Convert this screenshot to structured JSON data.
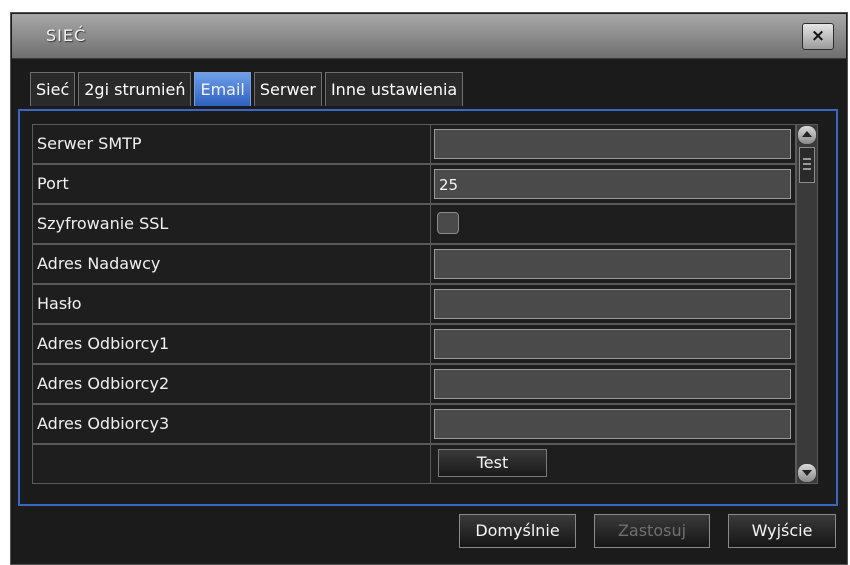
{
  "window": {
    "title": "SIEĆ",
    "close_label": "×"
  },
  "tabs": [
    {
      "label": "Sieć",
      "active": false
    },
    {
      "label": "2gi strumień",
      "active": false
    },
    {
      "label": "Email",
      "active": true
    },
    {
      "label": "Serwer",
      "active": false
    },
    {
      "label": "Inne ustawienia",
      "active": false
    }
  ],
  "form": {
    "rows": [
      {
        "label": "Serwer SMTP",
        "type": "text",
        "value": ""
      },
      {
        "label": "Port",
        "type": "text",
        "value": "25"
      },
      {
        "label": "Szyfrowanie SSL",
        "type": "checkbox",
        "checked": false
      },
      {
        "label": "Adres Nadawcy",
        "type": "text",
        "value": ""
      },
      {
        "label": "Hasło",
        "type": "text",
        "value": ""
      },
      {
        "label": "Adres Odbiorcy1",
        "type": "text",
        "value": ""
      },
      {
        "label": "Adres Odbiorcy2",
        "type": "text",
        "value": ""
      },
      {
        "label": "Adres Odbiorcy3",
        "type": "text",
        "value": ""
      },
      {
        "label": "",
        "type": "button",
        "button_label": "Test"
      }
    ]
  },
  "buttons": {
    "default_label": "Domyślnie",
    "apply_label": "Zastosuj",
    "exit_label": "Wyjście"
  },
  "colors": {
    "accent": "#3a66c4",
    "active_tab": "#2f5fc0",
    "background": "#1b1b1b"
  }
}
